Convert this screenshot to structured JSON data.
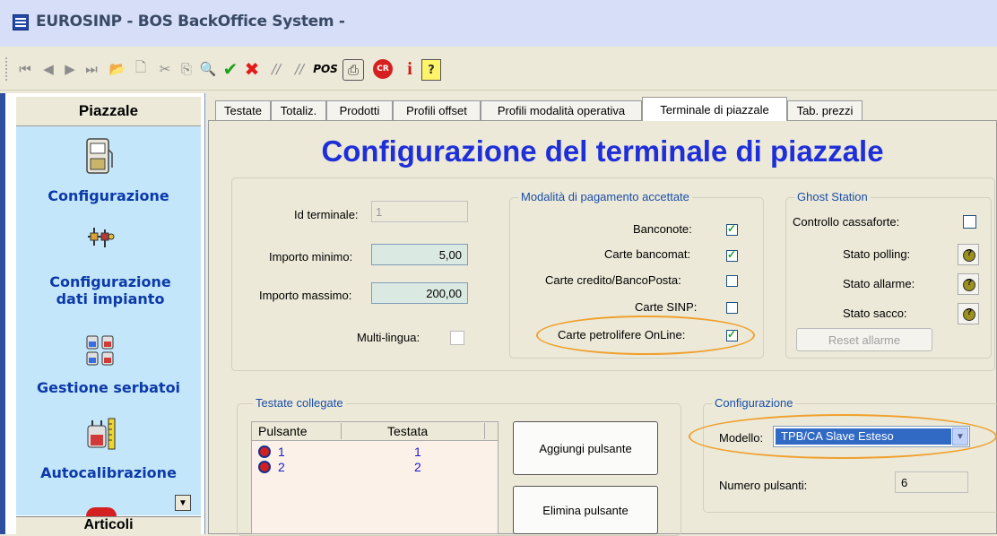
{
  "window": {
    "title": "EUROSINP - BOS BackOffice System -"
  },
  "toolbar": {
    "buttons": [
      {
        "name": "first-record",
        "glyph": "⏮"
      },
      {
        "name": "prev-record",
        "glyph": "◀"
      },
      {
        "name": "next-record",
        "glyph": "▶"
      },
      {
        "name": "last-record",
        "glyph": "⏭"
      },
      {
        "name": "open",
        "glyph": "📂"
      },
      {
        "name": "new",
        "glyph": "🗋"
      },
      {
        "name": "cut",
        "glyph": "✂"
      },
      {
        "name": "copy",
        "glyph": "⎘"
      },
      {
        "name": "search",
        "glyph": "🔍"
      },
      {
        "name": "confirm",
        "glyph": "✔"
      },
      {
        "name": "cancel",
        "glyph": "✖"
      },
      {
        "name": "draw-1",
        "glyph": "⫽"
      },
      {
        "name": "draw-2",
        "glyph": "⫽"
      },
      {
        "name": "pos",
        "glyph": "POS"
      },
      {
        "name": "print",
        "glyph": "⎙"
      },
      {
        "name": "cr",
        "glyph": "CR"
      },
      {
        "name": "info",
        "glyph": "i"
      },
      {
        "name": "help",
        "glyph": "?"
      }
    ]
  },
  "sidebar": {
    "header": "Piazzale",
    "items": [
      {
        "label": "Configurazione"
      },
      {
        "label": "Configurazione dati impianto"
      },
      {
        "label": "Gestione serbatoi"
      },
      {
        "label": "Autocalibrazione"
      }
    ],
    "footer": "Articoli"
  },
  "tabs": [
    {
      "label": "Testate",
      "active": false
    },
    {
      "label": "Totaliz.",
      "active": false
    },
    {
      "label": "Prodotti",
      "active": false
    },
    {
      "label": "Profili offset",
      "active": false
    },
    {
      "label": "Profili modalità operativa",
      "active": false
    },
    {
      "label": "Terminale di piazzale",
      "active": true
    },
    {
      "label": "Tab. prezzi",
      "active": false
    }
  ],
  "page": {
    "heading": "Configurazione del terminale di piazzale"
  },
  "terminal": {
    "id_label": "Id terminale:",
    "id_value": "1",
    "min_label": "Importo minimo:",
    "min_value": "5,00",
    "max_label": "Importo massimo:",
    "max_value": "200,00",
    "multilingua_label": "Multi-lingua:",
    "multilingua_checked": false
  },
  "payment": {
    "title": "Modalità di pagamento accettate",
    "options": [
      {
        "label": "Banconote:",
        "checked": true
      },
      {
        "label": "Carte bancomat:",
        "checked": true
      },
      {
        "label": "Carte credito/BancoPosta:",
        "checked": false
      },
      {
        "label": "Carte SINP:",
        "checked": false
      },
      {
        "label": "Carte petrolifere OnLine:",
        "checked": true
      }
    ]
  },
  "ghost": {
    "title": "Ghost Station",
    "cassaforte_label": "Controllo cassaforte:",
    "cassaforte_checked": false,
    "polling_label": "Stato polling:",
    "allarme_label": "Stato allarme:",
    "sacco_label": "Stato sacco:",
    "reset_button": "Reset allarme"
  },
  "testate": {
    "title": "Testate collegate",
    "columns": [
      "Pulsante",
      "Testata"
    ],
    "rows": [
      {
        "pulsante": "1",
        "testata": "1"
      },
      {
        "pulsante": "2",
        "testata": "2"
      }
    ],
    "add_button": "Aggiungi pulsante",
    "delete_button": "Elimina pulsante"
  },
  "config": {
    "title": "Configurazione",
    "model_label": "Modello:",
    "model_value": "TPB/CA Slave Esteso",
    "num_label": "Numero pulsanti:",
    "num_value": "6"
  },
  "colors": {
    "accent": "#1f2fd8",
    "sidebar_bg": "#c3e6fb",
    "highlight": "#f0a02c",
    "select_bg": "#316ac5"
  }
}
